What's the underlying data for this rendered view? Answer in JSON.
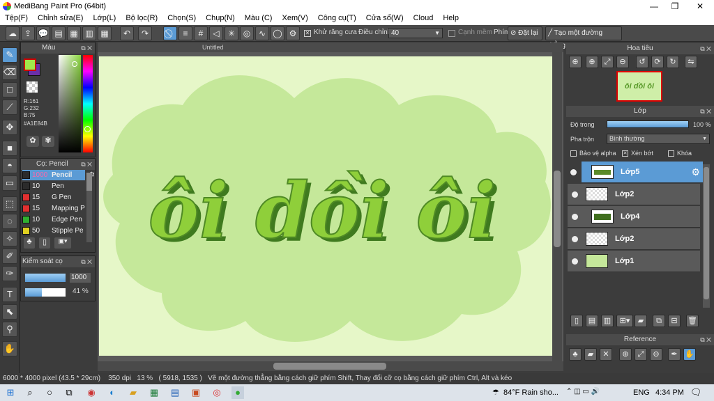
{
  "window": {
    "title": "MediBang Paint Pro (64bit)",
    "minimize": "—",
    "maximize": "❐",
    "close": "✕"
  },
  "menu": [
    "Tệp(F)",
    "Chỉnh sửa(E)",
    "Lớp(L)",
    "Bộ lọc(R)",
    "Chọn(S)",
    "Chụp(N)",
    "Màu (C)",
    "Xem(V)",
    "Công cụ(T)",
    "Cửa sổ(W)",
    "Cloud",
    "Help"
  ],
  "toolbar": {
    "antialias_label": "Khử răng cưa",
    "adjust_label": "Điều chỉnh",
    "adjust_value": "40",
    "soft_edge_label": "Cạnh mềm",
    "key_label": "Phím",
    "reset_label": "Đặt lại",
    "straight_line_label": "Tạo một đường thẳng"
  },
  "color_panel": {
    "title": "Màu",
    "r": "R:161",
    "g": "G:232",
    "b": "B:75",
    "hex": "#A1E84B",
    "primary_color": "#A1E84B",
    "secondary_color": "#6a2fa8"
  },
  "brush_panel": {
    "title": "Cọ: Pencil",
    "items": [
      {
        "size": "1000",
        "name": "Pencil",
        "color": "#2b2b2b"
      },
      {
        "size": "10",
        "name": "Pen",
        "color": "#2b2b2b"
      },
      {
        "size": "15",
        "name": "G Pen",
        "color": "#e03030"
      },
      {
        "size": "15",
        "name": "Mapping P",
        "color": "#e03030"
      },
      {
        "size": "10",
        "name": "Edge Pen",
        "color": "#30b030"
      },
      {
        "size": "50",
        "name": "Stipple Pe",
        "color": "#e0d020"
      }
    ]
  },
  "brush_control": {
    "title": "Kiểm soát cọ",
    "size_value": "1000",
    "opacity_value": "41 %",
    "opacity_fraction": 0.41
  },
  "canvas": {
    "tab_title": "Untitled",
    "artwork_text": "ôi dồi ôi",
    "background": "#e6f7c8"
  },
  "navigator": {
    "title": "Hoa tiêu"
  },
  "layer_panel": {
    "title": "Lớp",
    "opacity_label": "Độ trong",
    "opacity_value": "100 %",
    "blend_label": "Pha trộn",
    "blend_value": "Bình thường",
    "protect_alpha": "Bảo vệ alpha",
    "clipping": "Xén bớt",
    "lock": "Khóa",
    "layers": [
      {
        "name": "Lớp5",
        "selected": true
      },
      {
        "name": "Lớp2",
        "selected": false
      },
      {
        "name": "Lớp4",
        "selected": false
      },
      {
        "name": "Lớp2",
        "selected": false
      },
      {
        "name": "Lớp1",
        "selected": false
      }
    ]
  },
  "reference": {
    "title": "Reference"
  },
  "status": {
    "size": "6000 * 4000 pixel",
    "cm": "(43.5 * 29cm)",
    "dpi": "350 dpi",
    "zoom": "13 %",
    "coords": "( 5918, 1535 )",
    "hint": "Vẽ một đường thẳng bằng cách giữ phím Shift, Thay đổi cỡ cọ bằng cách giữ phím Ctrl, Alt và kéo"
  },
  "taskbar": {
    "weather": "84°F  Rain sho...",
    "lang": "ENG",
    "time": "4:34 PM"
  }
}
